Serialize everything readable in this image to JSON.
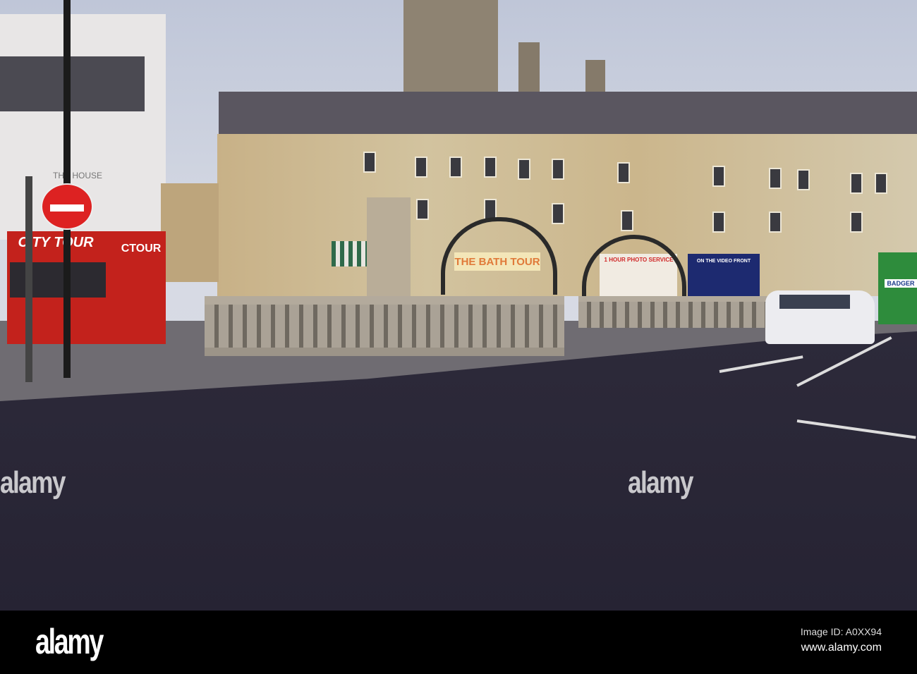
{
  "photo": {
    "signs": {
      "bath_tour": "THE BATH TOUR",
      "city_tour": "CITY TOUR",
      "tour_side": "CTOUR",
      "photo_service": "1 HOUR PHOTO SERVICE",
      "video_front": "ON THE VIDEO FRONT",
      "badger": "BADGER",
      "house": "THE HOUSE"
    },
    "watermarks": [
      "alamy",
      "alamy"
    ]
  },
  "footer": {
    "logo": "alamy",
    "image_id": "Image ID: A0XX94",
    "url": "www.alamy.com"
  }
}
